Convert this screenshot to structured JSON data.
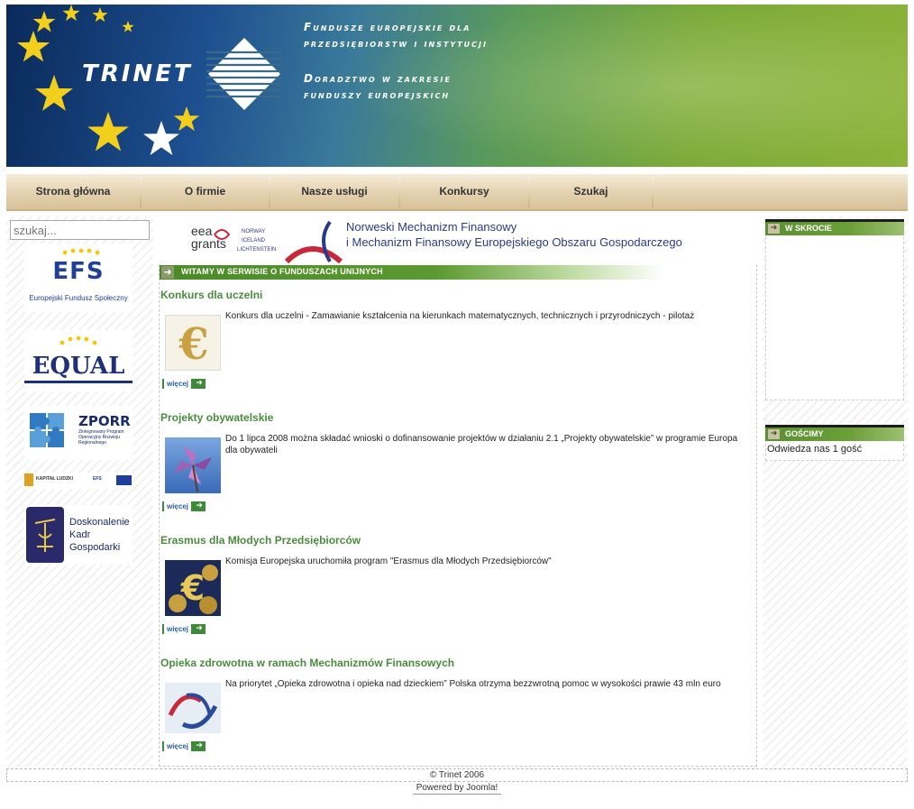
{
  "header": {
    "logo_text": "TRINET",
    "tagline_1a": "Fundusze europejskie dla",
    "tagline_1b": "przedsiębiorstw i instytucji",
    "tagline_2a": "Doradztwo w zakresie",
    "tagline_2b": "funduszy europejskich"
  },
  "nav": {
    "items": [
      {
        "label": "Strona główna"
      },
      {
        "label": "O firmie"
      },
      {
        "label": "Nasze usługi"
      },
      {
        "label": "Konkursy"
      },
      {
        "label": "Szukaj"
      }
    ]
  },
  "search": {
    "placeholder": "szukaj..."
  },
  "left_banners": {
    "efs_title": "EFS",
    "efs_sub": "Europejski Fundusz Społeczny",
    "equal_title": "EQUAL",
    "zporr_title": "ZPORR",
    "zporr_sub": "Zintegrowany Program Operacyjny Rozwoju Regionalnego",
    "kl_a": "KAPITAŁ LUDZKI",
    "kl_b": "EFS",
    "dkg_1": "Doskonalenie",
    "dkg_2": "Kadr",
    "dkg_3": "Gospodarki"
  },
  "eea": {
    "logo_top": "eea",
    "logo_bottom": "grants",
    "countries": [
      "NORWAY",
      "ICELAND",
      "LICHTENSTEIN"
    ],
    "line1": "Norweski Mechanizm Finansowy",
    "line2": "i Mechanizm Finansowy Europejskiego Obszaru Gospodarczego"
  },
  "welcome_title": "WITAMY W SERWISIE O FUNDUSZACH UNIJNYCH",
  "more_label": "więcej",
  "articles": [
    {
      "title": "Konkurs dla uczelni",
      "text": "Konkurs dla uczelni - Zamawianie kształcenia na kierunkach matematycznych, technicznych i przyrodniczych - pilotaż"
    },
    {
      "title": "Projekty obywatelskie",
      "text": "Do 1 lipca 2008 można składać wnioski o dofinansowanie projektów w działaniu 2.1 „Projekty obywatelskie” w programie Europa dla obywateli"
    },
    {
      "title": "Erasmus dla Młodych Przedsiębiorców",
      "text": "Komisja Europejska uruchomiła program \"Erasmus dla Młodych Przedsiębiorców\""
    },
    {
      "title": "Opieka zdrowotna w ramach Mechanizmów Finansowych",
      "text": "Na priorytet „Opieka zdrowotna i opieka nad dzieckiem” Polska otrzyma bezzwrotną pomoc w wysokości prawie 43 mln euro"
    }
  ],
  "right": {
    "skrocie_title": "W SKROCIE",
    "goscimy_title": "GOŚCIMY",
    "goscimy_text": "Odwiedza nas 1 gość"
  },
  "footer": {
    "copyright": "© Trinet 2006",
    "powered": "Powered by Joomla!"
  },
  "colors": {
    "article_title": "#4a8c3c",
    "green_bar": "#5c9a30",
    "nav_bg": "#e4d1ae"
  }
}
